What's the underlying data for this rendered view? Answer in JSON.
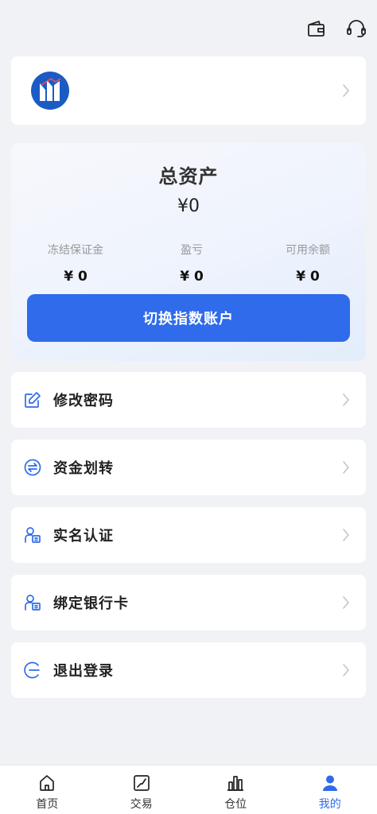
{
  "header": {
    "icons": [
      "wallet-icon",
      "headset-icon"
    ]
  },
  "profile": {
    "logo": "brand-logo-icon"
  },
  "assets": {
    "title": "总资产",
    "total": "¥0",
    "items": [
      {
        "label": "冻结保证金",
        "value": "¥ 0"
      },
      {
        "label": "盈亏",
        "value": "¥ 0"
      },
      {
        "label": "可用余额",
        "value": "¥ 0"
      }
    ],
    "switch_button": "切换指数账户"
  },
  "menu": [
    {
      "label": "修改密码",
      "icon": "edit-icon"
    },
    {
      "label": "资金划转",
      "icon": "transfer-icon"
    },
    {
      "label": "实名认证",
      "icon": "id-card-icon"
    },
    {
      "label": "绑定银行卡",
      "icon": "bank-card-icon"
    },
    {
      "label": "退出登录",
      "icon": "logout-icon"
    }
  ],
  "nav": {
    "items": [
      {
        "label": "首页",
        "icon": "home-icon"
      },
      {
        "label": "交易",
        "icon": "trade-icon"
      },
      {
        "label": "仓位",
        "icon": "position-icon"
      },
      {
        "label": "我的",
        "icon": "user-icon"
      }
    ],
    "active_index": 3
  },
  "colors": {
    "accent": "#2f6bea",
    "background": "#f1f2f6",
    "text": "#222222",
    "muted": "#999999"
  }
}
